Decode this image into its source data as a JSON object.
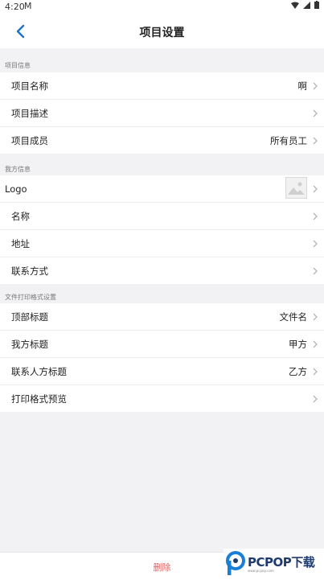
{
  "status_bar": {
    "time": "4:20",
    "mail_glyph": "M"
  },
  "nav": {
    "title": "项目设置"
  },
  "sections": {
    "project": {
      "header": "项目信息",
      "rows": [
        {
          "label": "项目名称",
          "value": "啊"
        },
        {
          "label": "项目描述",
          "value": ""
        },
        {
          "label": "项目成员",
          "value": "所有员工"
        }
      ]
    },
    "company": {
      "header": "我方信息",
      "rows": [
        {
          "label": "Logo"
        },
        {
          "label": "名称"
        },
        {
          "label": "地址"
        },
        {
          "label": "联系方式"
        }
      ]
    },
    "print": {
      "header": "文件打印格式设置",
      "rows": [
        {
          "label": "顶部标题",
          "value": "文件名"
        },
        {
          "label": "我方标题",
          "value": "甲方"
        },
        {
          "label": "联系人方标题",
          "value": "乙方"
        },
        {
          "label": "打印格式预览",
          "value": ""
        }
      ]
    }
  },
  "bottom": {
    "delete_label": "删除"
  },
  "watermark": {
    "text": "PCPOP下载",
    "sub": "www.pcpop.com"
  },
  "colors": {
    "accent": "#1a73c8",
    "delete": "#e26060",
    "background": "#f2f2f5"
  }
}
